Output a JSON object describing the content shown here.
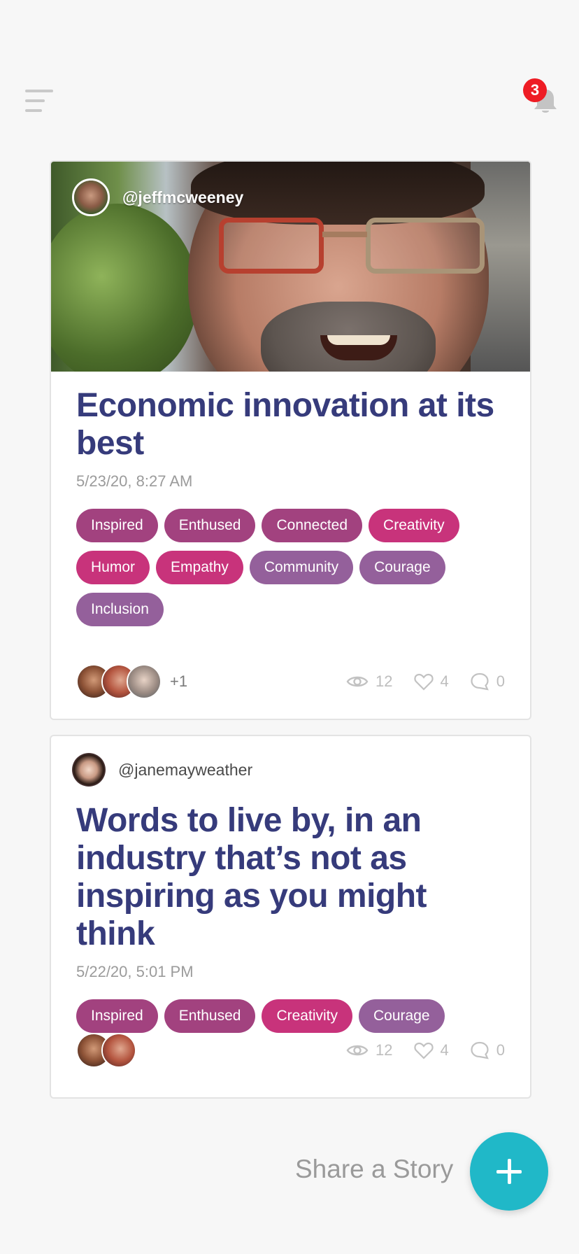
{
  "header": {
    "notification_count": "3",
    "menu_icon": "hamburger-menu-icon",
    "bell_icon": "bell-icon"
  },
  "stories": [
    {
      "author": "@jeffmcweeney",
      "title": "Economic innovation at its best",
      "date": "5/23/20, 8:27 AM",
      "tags": [
        {
          "label": "Inspired",
          "color": "#a2427f"
        },
        {
          "label": "Enthused",
          "color": "#a2427f"
        },
        {
          "label": "Connected",
          "color": "#a2427f"
        },
        {
          "label": "Creativity",
          "color": "#c8337b"
        },
        {
          "label": "Humor",
          "color": "#c8337b"
        },
        {
          "label": "Empathy",
          "color": "#c8337b"
        },
        {
          "label": "Community",
          "color": "#94609b"
        },
        {
          "label": "Courage",
          "color": "#94609b"
        },
        {
          "label": "Inclusion",
          "color": "#94609b"
        }
      ],
      "reactor_more": "+1",
      "views": "12",
      "likes": "4",
      "comments": "0"
    },
    {
      "author": "@janemayweather",
      "title": "Words to live by, in an industry that’s not as inspiring as you might think",
      "date": "5/22/20, 5:01 PM",
      "tags": [
        {
          "label": "Inspired",
          "color": "#a2427f"
        },
        {
          "label": "Enthused",
          "color": "#a2427f"
        },
        {
          "label": "Creativity",
          "color": "#c8337b"
        },
        {
          "label": "Courage",
          "color": "#94609b"
        }
      ],
      "views": "12",
      "likes": "4",
      "comments": "0"
    }
  ],
  "share": {
    "label": "Share a Story",
    "fab_icon": "plus-icon",
    "color": "#20b8c8"
  },
  "colors": {
    "title": "#363b7b",
    "tag_plum": "#a2427f",
    "tag_pink": "#c8337b",
    "tag_violet": "#94609b",
    "badge": "#ee1c24"
  }
}
